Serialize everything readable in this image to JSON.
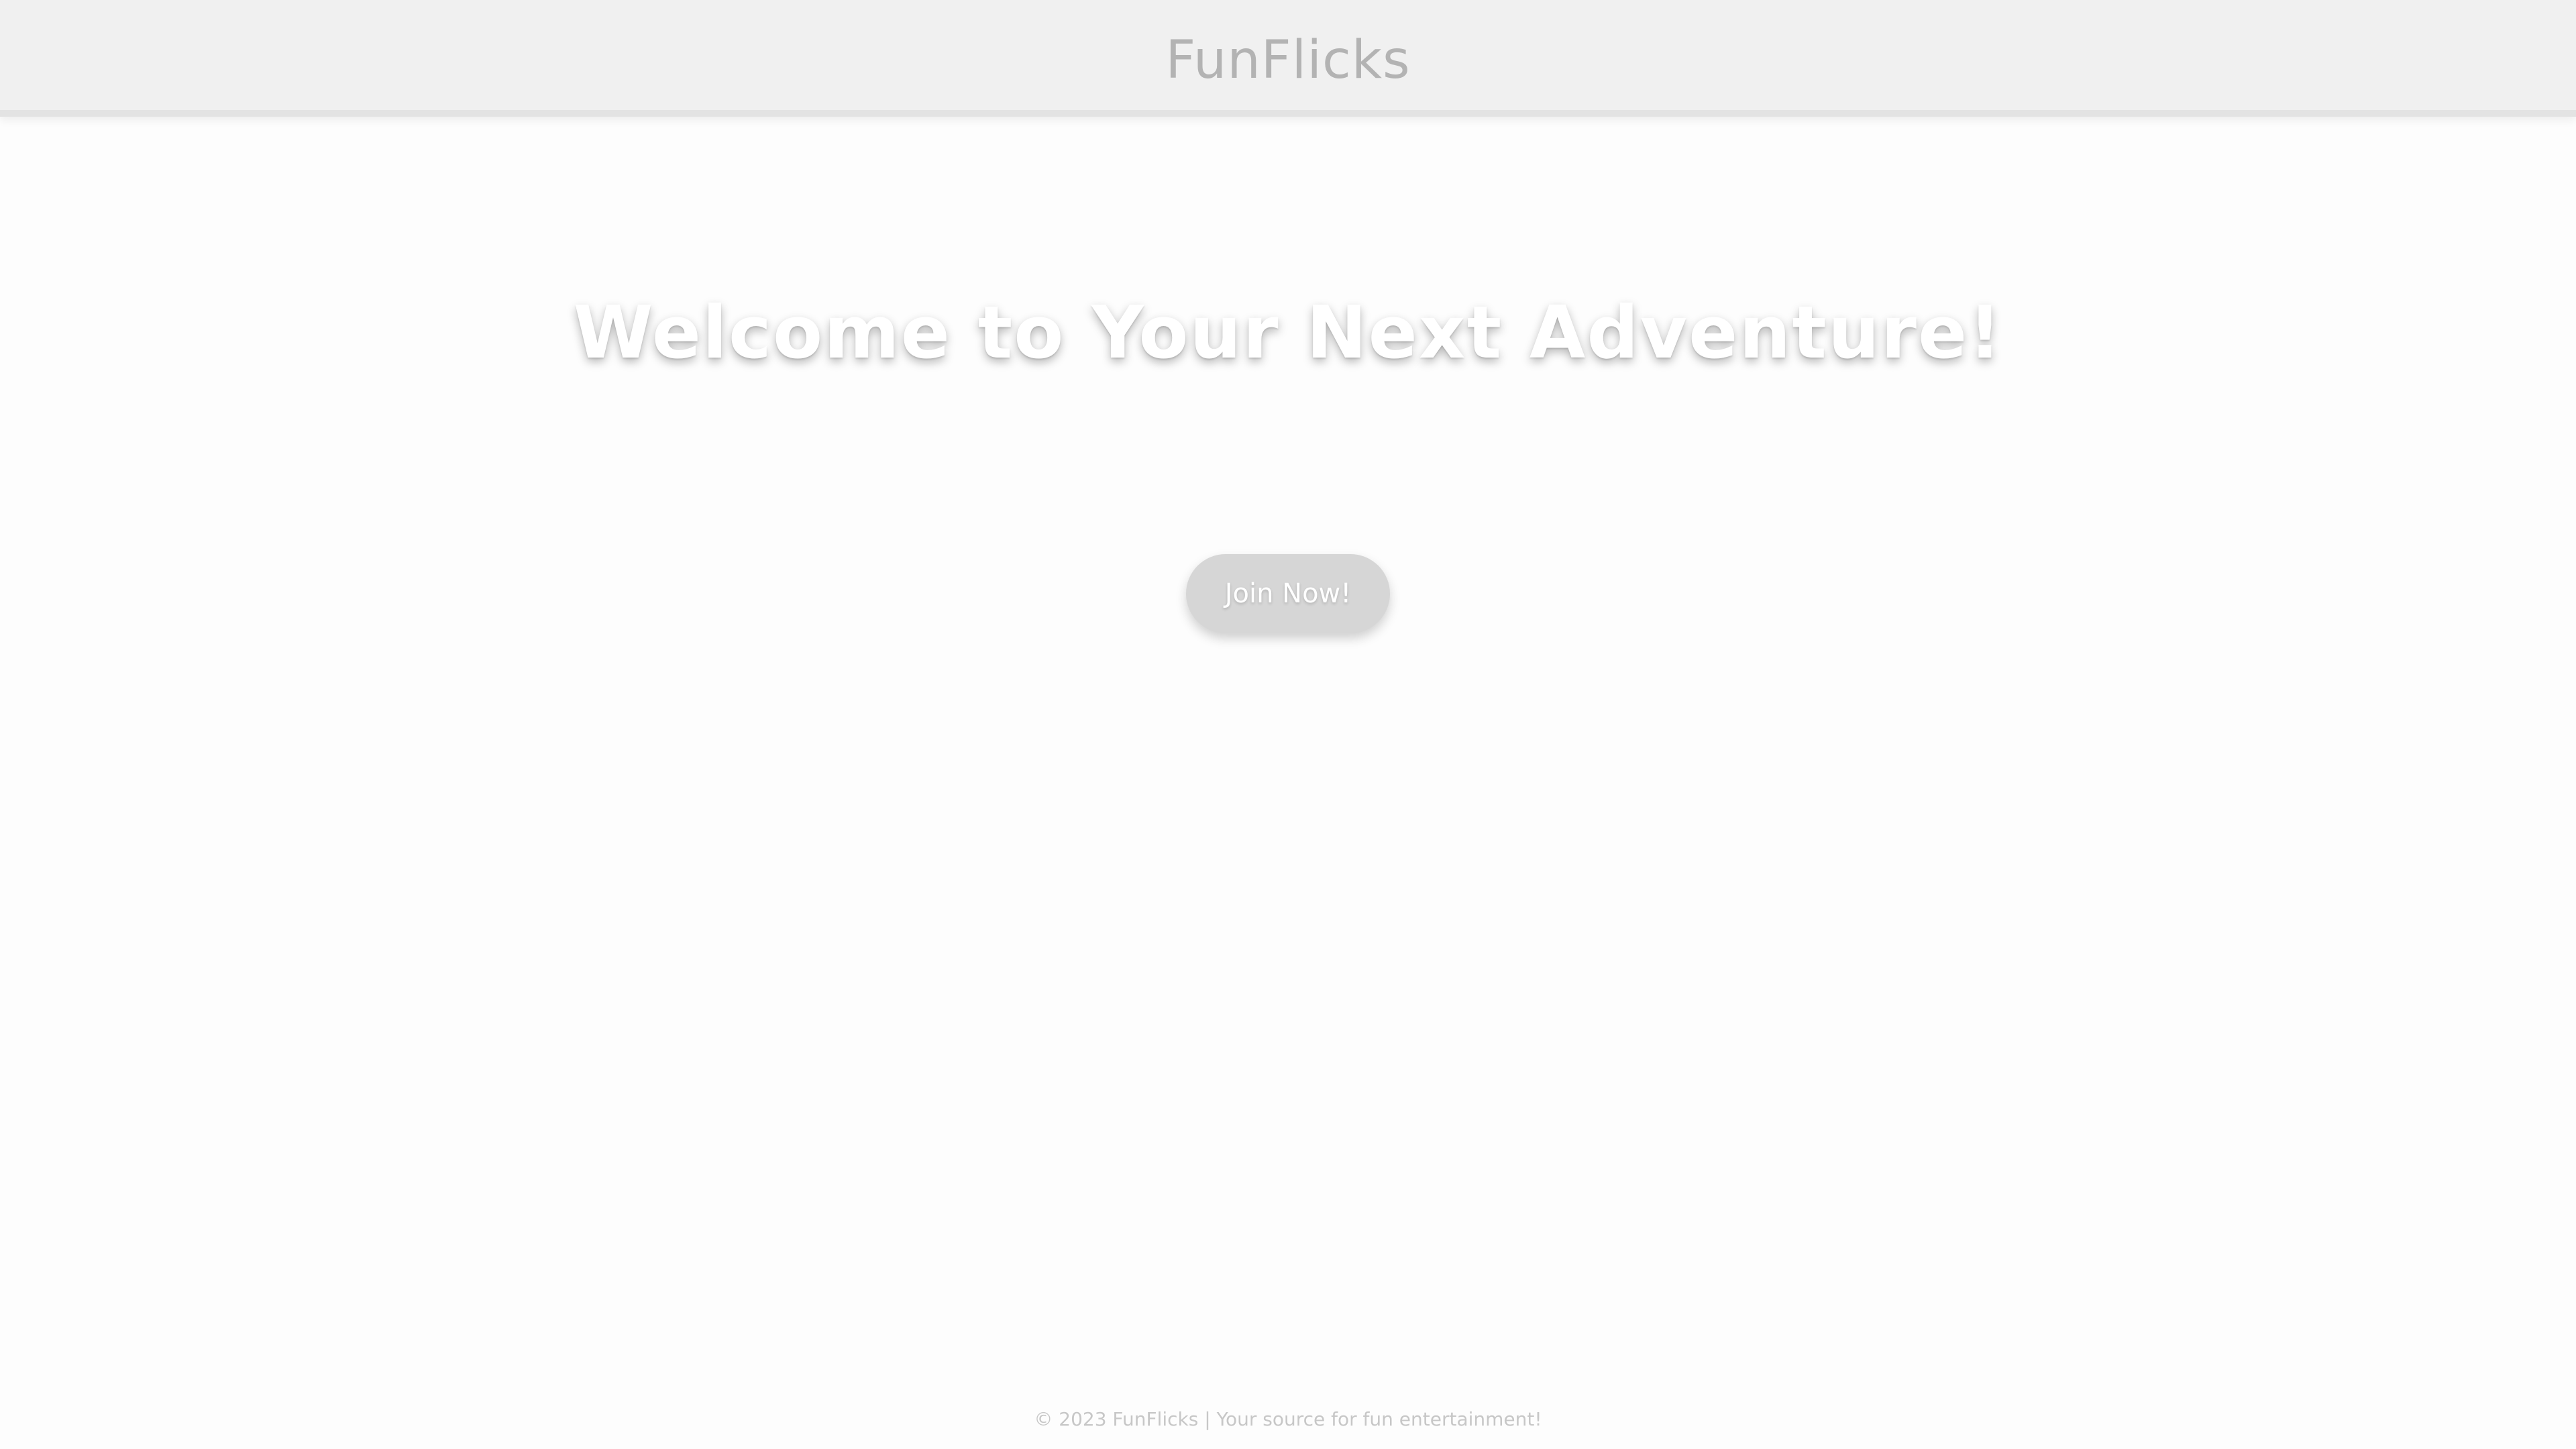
{
  "header": {
    "brand": "FunFlicks"
  },
  "hero": {
    "title": "Welcome to Your Next Adventure!",
    "cta_label": "Join Now!"
  },
  "footer": {
    "text": "© 2023 FunFlicks | Your source for fun entertainment!"
  }
}
